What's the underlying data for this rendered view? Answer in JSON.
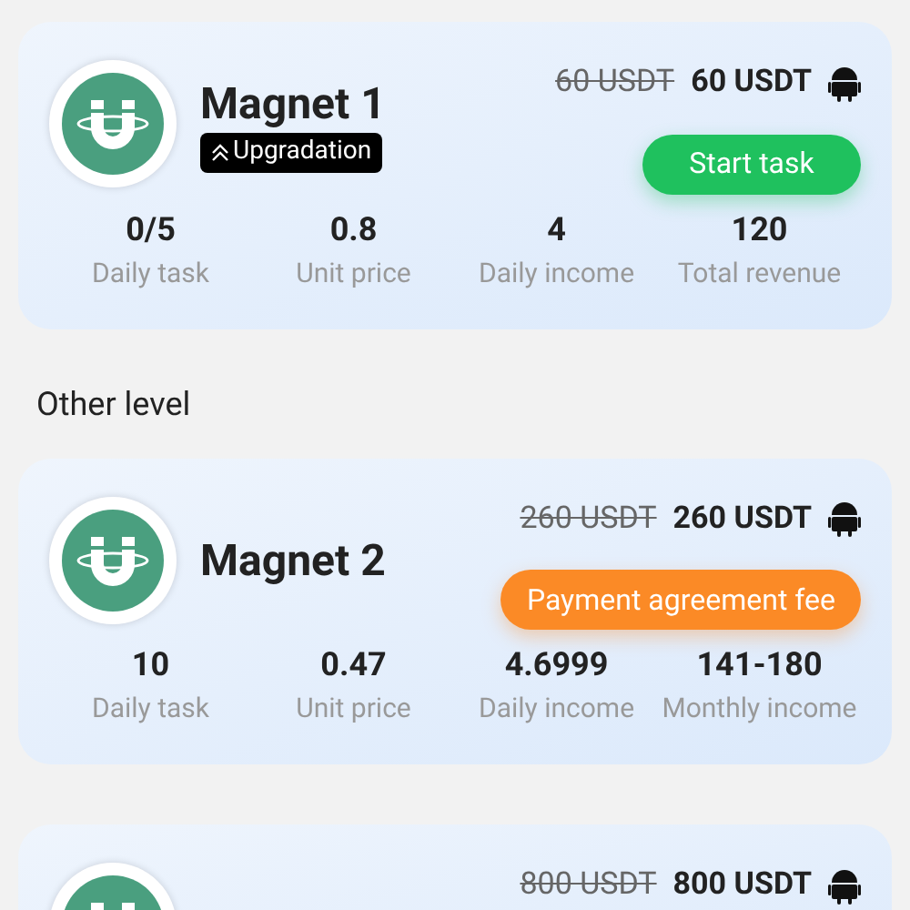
{
  "cards": [
    {
      "name": "Magnet 1",
      "badge": "Upgradation",
      "old_price": "60 USDT",
      "price": "60 USDT",
      "button": {
        "label": "Start task",
        "kind": "green"
      },
      "stats": [
        {
          "value": "0/5",
          "label": "Daily task"
        },
        {
          "value": "0.8",
          "label": "Unit price"
        },
        {
          "value": "4",
          "label": "Daily income"
        },
        {
          "value": "120",
          "label": "Total revenue"
        }
      ]
    },
    {
      "section_title": "Other level",
      "name": "Magnet 2",
      "old_price": "260 USDT",
      "price": "260 USDT",
      "button": {
        "label": "Payment agreement fee",
        "kind": "orange"
      },
      "stats": [
        {
          "value": "10",
          "label": "Daily task"
        },
        {
          "value": "0.47",
          "label": "Unit price"
        },
        {
          "value": "4.6999",
          "label": "Daily income"
        },
        {
          "value": "141-180",
          "label": "Monthly income"
        }
      ]
    },
    {
      "old_price": "800 USDT",
      "price": "800 USDT"
    }
  ]
}
